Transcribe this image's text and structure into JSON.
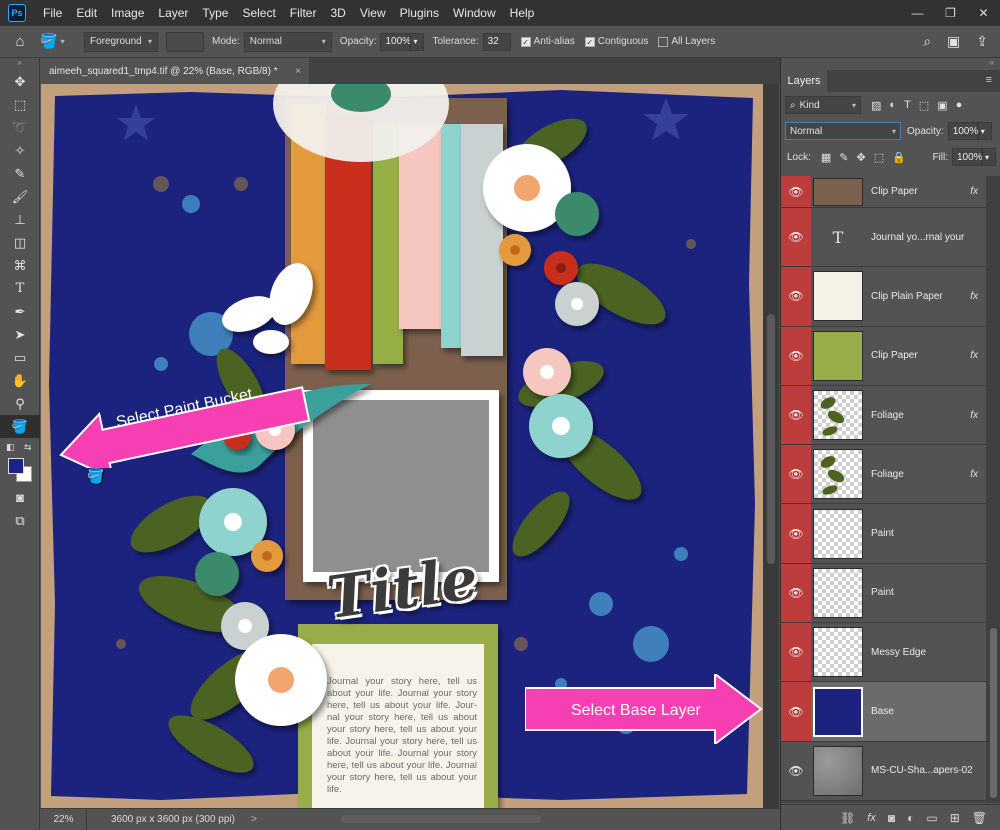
{
  "app": {
    "logo": "Ps"
  },
  "menu": [
    "File",
    "Edit",
    "Image",
    "Layer",
    "Type",
    "Select",
    "Filter",
    "3D",
    "View",
    "Plugins",
    "Window",
    "Help"
  ],
  "window_controls": {
    "minimize": "—",
    "restore": "❐",
    "close": "✕"
  },
  "options": {
    "fill_source": "Foreground",
    "mode_label": "Mode:",
    "mode_value": "Normal",
    "opacity_label": "Opacity:",
    "opacity_value": "100%",
    "tolerance_label": "Tolerance:",
    "tolerance_value": "32",
    "anti_alias": "Anti-alias",
    "contiguous": "Contiguous",
    "all_layers": "All Layers"
  },
  "document": {
    "tab_title": "aimeeh_squared1_tmp4.tif @ 22% (Base, RGB/8) *",
    "close": "×"
  },
  "status": {
    "zoom": "22%",
    "info": "3600 px x 3600 px (300 ppi)",
    "arrow": ">"
  },
  "colors": {
    "foreground": "#1b2385",
    "background": "#ffffff",
    "accent_pink": "#f53fb3",
    "layer_red": "#bd3c3c"
  },
  "layers_panel": {
    "tab": "Layers",
    "kind_label": "Kind",
    "blend_mode": "Normal",
    "opacity_label": "Opacity:",
    "opacity_value": "100%",
    "lock_label": "Lock:",
    "fill_label": "Fill:",
    "fill_value": "100%",
    "layers": [
      {
        "name": "Clip Paper",
        "fx": "fx",
        "type": "paper-brown"
      },
      {
        "name": "Journal yo...rnal your",
        "fx": "",
        "type": "text"
      },
      {
        "name": "Clip Plain Paper",
        "fx": "fx",
        "type": "paper-cream"
      },
      {
        "name": "Clip Paper",
        "fx": "fx",
        "type": "paper-green"
      },
      {
        "name": "Foliage",
        "fx": "fx",
        "type": "foliage"
      },
      {
        "name": "Foliage",
        "fx": "fx",
        "type": "foliage"
      },
      {
        "name": "Paint",
        "fx": "",
        "type": "transparent"
      },
      {
        "name": "Paint",
        "fx": "",
        "type": "transparent"
      },
      {
        "name": "Messy Edge",
        "fx": "",
        "type": "transparent"
      },
      {
        "name": "Base",
        "fx": "",
        "type": "base"
      },
      {
        "name": "MS-CU-Sha...apers-02",
        "fx": "",
        "type": "texture"
      }
    ]
  },
  "canvas": {
    "title_word": "Title",
    "journal_text": "Journal your story here, tell us about your life. Journal your story here, tell us about your life. Jour-nal your story here, tell us about your story here, tell us about your life. Journal your story here, tell us about your life. Journal your story here, tell us about your life. Journal your story here, tell us about your life."
  },
  "callouts": {
    "paint_bucket": "Select Paint Bucket",
    "base_layer": "Select Base Layer"
  }
}
